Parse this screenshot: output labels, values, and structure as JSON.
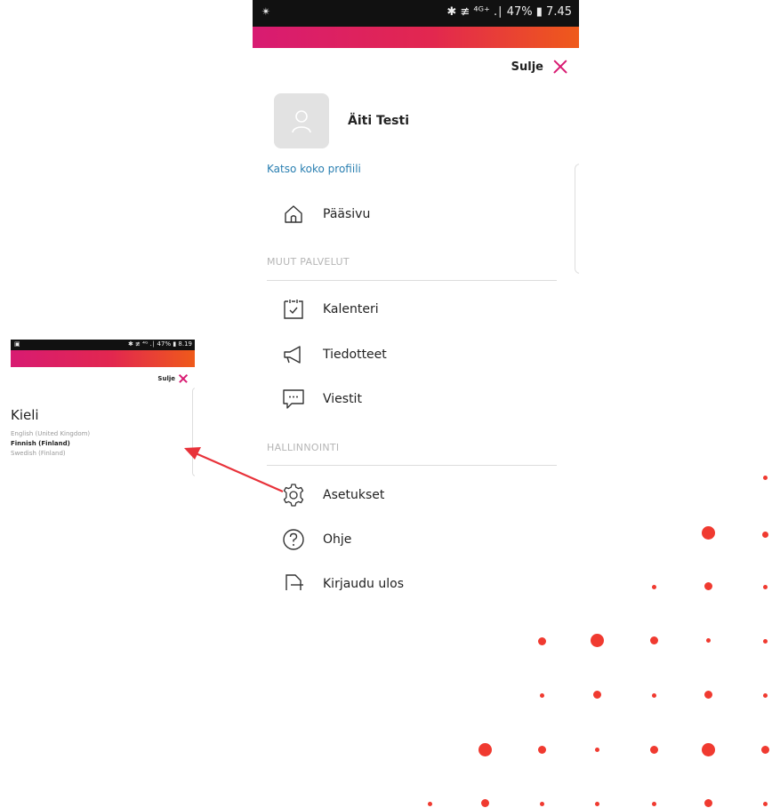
{
  "main_phone": {
    "status_left": "✴",
    "status_right": "✱ ≢ ⁴ᴳ⁺ .∣ 47% ▮ 7.45",
    "close_label": "Sulje",
    "user_name": "Äiti Testi",
    "profile_link": "Katso koko profiili",
    "menu": [
      {
        "label": "Pääsivu",
        "icon": "home-icon"
      },
      {
        "label": "Kalenteri",
        "icon": "calendar-icon"
      },
      {
        "label": "Tiedotteet",
        "icon": "megaphone-icon"
      },
      {
        "label": "Viestit",
        "icon": "message-icon"
      },
      {
        "label": "Asetukset",
        "icon": "gear-icon"
      },
      {
        "label": "Ohje",
        "icon": "help-icon"
      },
      {
        "label": "Kirjaudu ulos",
        "icon": "logout-icon"
      }
    ],
    "sections": {
      "other_services": "MUUT PALVELUT",
      "administration": "HALLINNOINTI"
    }
  },
  "small_phone": {
    "status_left": "▣",
    "status_right": "✱ ≢ ⁴ᴳ .∣ 47% ▮ 8.19",
    "close_label": "Sulje",
    "title": "Kieli",
    "languages": [
      {
        "label": "English (United Kingdom)",
        "selected": false
      },
      {
        "label": "Finnish (Finland)",
        "selected": true
      },
      {
        "label": "Swedish (Finland)",
        "selected": false
      }
    ]
  },
  "colors": {
    "accent": "#d81b72",
    "link": "#2a7fb1",
    "arrow": "#e8323a",
    "dots": "#f03a30"
  }
}
